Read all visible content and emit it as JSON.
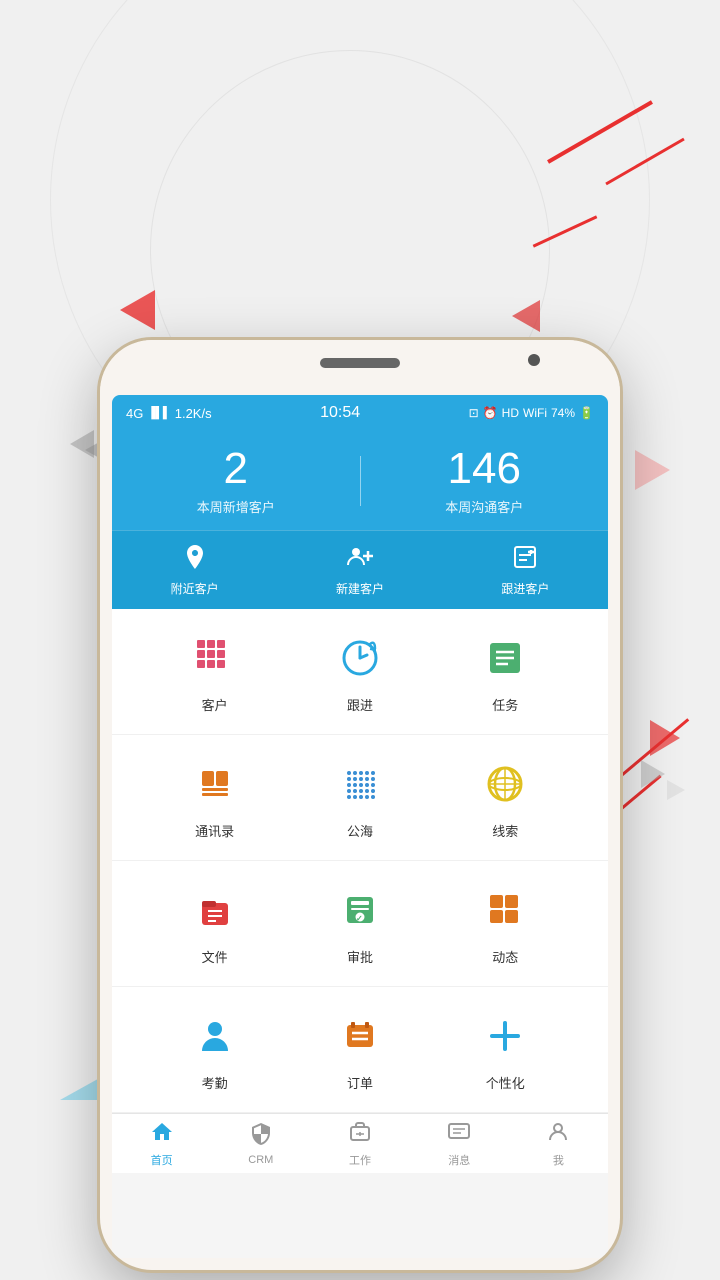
{
  "background": {
    "color": "#eeeeee"
  },
  "status_bar": {
    "network": "4G",
    "signal": "1.2K/s",
    "time": "10:54",
    "battery": "74%",
    "hd": "HD"
  },
  "header": {
    "stat1_number": "2",
    "stat1_label": "本周新增客户",
    "stat2_number": "146",
    "stat2_label": "本周沟通客户"
  },
  "quick_actions": [
    {
      "id": "nearby",
      "label": "附近客户",
      "icon": "📍"
    },
    {
      "id": "new",
      "label": "新建客户",
      "icon": "👥"
    },
    {
      "id": "follow",
      "label": "跟进客户",
      "icon": "📋"
    }
  ],
  "app_rows": [
    [
      {
        "id": "customer",
        "label": "客户",
        "icon_type": "grid-pink"
      },
      {
        "id": "followup",
        "label": "跟进",
        "icon_type": "clock-blue"
      },
      {
        "id": "task",
        "label": "任务",
        "icon_type": "list-green"
      }
    ],
    [
      {
        "id": "contacts",
        "label": "通讯录",
        "icon_type": "book-orange"
      },
      {
        "id": "public",
        "label": "公海",
        "icon_type": "dots-blue"
      },
      {
        "id": "leads",
        "label": "线索",
        "icon_type": "globe-yellow"
      }
    ],
    [
      {
        "id": "files",
        "label": "文件",
        "icon_type": "folder-red"
      },
      {
        "id": "approve",
        "label": "审批",
        "icon_type": "calendar-green"
      },
      {
        "id": "dynamic",
        "label": "动态",
        "icon_type": "grid-orange"
      }
    ],
    [
      {
        "id": "attendance",
        "label": "考勤",
        "icon_type": "person-blue"
      },
      {
        "id": "order",
        "label": "订单",
        "icon_type": "list-orange"
      },
      {
        "id": "custom",
        "label": "个性化",
        "icon_type": "plus-blue"
      }
    ]
  ],
  "bottom_nav": [
    {
      "id": "home",
      "label": "首页",
      "active": true
    },
    {
      "id": "crm",
      "label": "CRM",
      "active": false
    },
    {
      "id": "work",
      "label": "工作",
      "active": false
    },
    {
      "id": "message",
      "label": "消息",
      "active": false
    },
    {
      "id": "me",
      "label": "我",
      "active": false
    }
  ]
}
